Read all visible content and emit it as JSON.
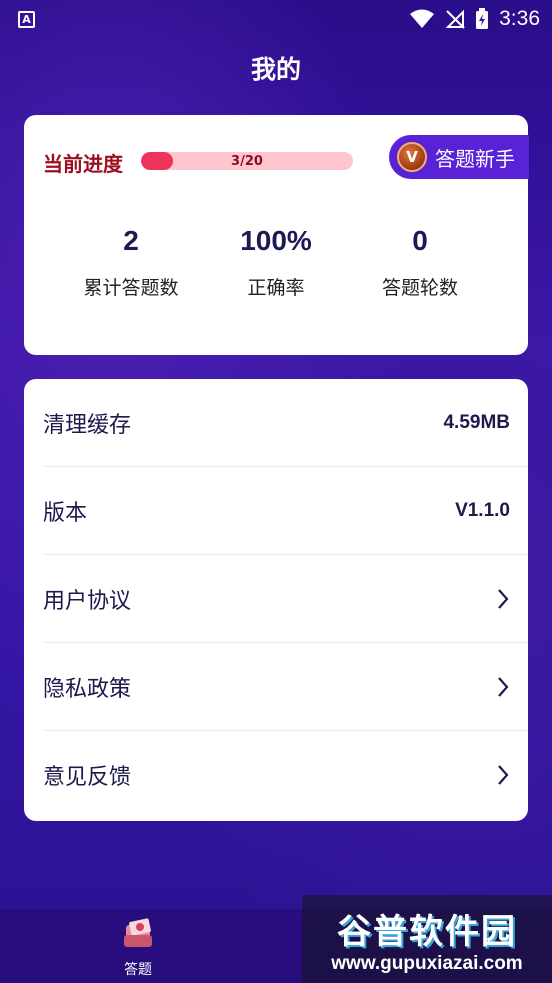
{
  "status_bar": {
    "time": "3:36",
    "app_badge": "A"
  },
  "header": {
    "title": "我的"
  },
  "progress": {
    "label": "当前进度",
    "text": "3/20",
    "fraction": 0.15,
    "level_badge_letter": "V",
    "level_label": "答题新手"
  },
  "stats": [
    {
      "value": "2",
      "label": "累计答题数"
    },
    {
      "value": "100%",
      "label": "正确率"
    },
    {
      "value": "0",
      "label": "答题轮数"
    }
  ],
  "settings": [
    {
      "label": "清理缓存",
      "value": "4.59MB"
    },
    {
      "label": "版本",
      "value": "V1.1.0"
    },
    {
      "label": "用户协议",
      "value": ""
    },
    {
      "label": "隐私政策",
      "value": ""
    },
    {
      "label": "意见反馈",
      "value": ""
    }
  ],
  "bottom_nav": {
    "items": [
      {
        "label": "答题",
        "icon": "quiz-icon"
      }
    ]
  },
  "watermark": {
    "title": "谷普软件园",
    "url": "www.gupuxiazai.com"
  },
  "colors": {
    "accent": "#5a22d6",
    "progress_fill": "#f0335a",
    "progress_track": "#ffc6d0",
    "progress_label": "#9a0f1f"
  }
}
